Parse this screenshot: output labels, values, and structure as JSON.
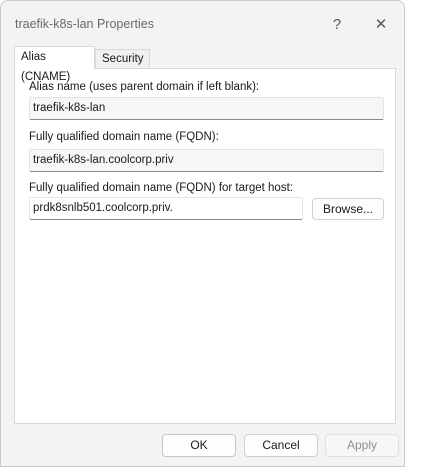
{
  "window": {
    "title": "traefik-k8s-lan Properties",
    "help_glyph": "?",
    "close_glyph": "✕"
  },
  "tabs": [
    {
      "label": "Alias (CNAME)",
      "active": true
    },
    {
      "label": "Security",
      "active": false
    }
  ],
  "form": {
    "alias_label": "Alias name (uses parent domain if left blank):",
    "alias_value": "traefik-k8s-lan",
    "fqdn_label": "Fully qualified domain name (FQDN):",
    "fqdn_value": "traefik-k8s-lan.coolcorp.priv",
    "target_label": "Fully qualified domain name (FQDN) for target host:",
    "target_value": "prdk8snlb501.coolcorp.priv.",
    "browse_label": "Browse..."
  },
  "footer": {
    "ok_label": "OK",
    "cancel_label": "Cancel",
    "apply_label": "Apply"
  }
}
